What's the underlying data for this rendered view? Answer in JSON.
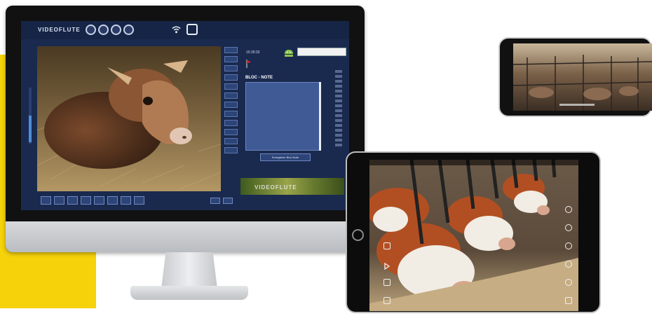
{
  "colors": {
    "accent_yellow": "#f6d20a",
    "app_background": "#1a2a4f",
    "panel_blue": "#3f5a95",
    "slider_blue": "#4e8ed7"
  },
  "desktop_app": {
    "title": "VIDEOFLUTE",
    "top_icons": [
      "circle-button-icon",
      "circle-button-icon",
      "circle-button-icon",
      "circle-button-icon",
      "wifi-icon",
      "device-icon"
    ],
    "time_text": "15:30:33",
    "notes_label": "BLOC - NOTE",
    "notes_button": "Enregistrer Bloc Note",
    "stamp_text": "VIDEOFLUTE",
    "side_buttons": 12,
    "bottom_tools": 8,
    "volume_level": 0.47
  },
  "tablet_app": {
    "left_icons": [
      "square-icon",
      "home-icon",
      "triangle-icon",
      "gallery-icon",
      "frame-icon"
    ],
    "right_icons": [
      "settings-icon",
      "circle-icon",
      "circle-icon",
      "circle-icon",
      "circle-icon",
      "square-icon"
    ]
  }
}
